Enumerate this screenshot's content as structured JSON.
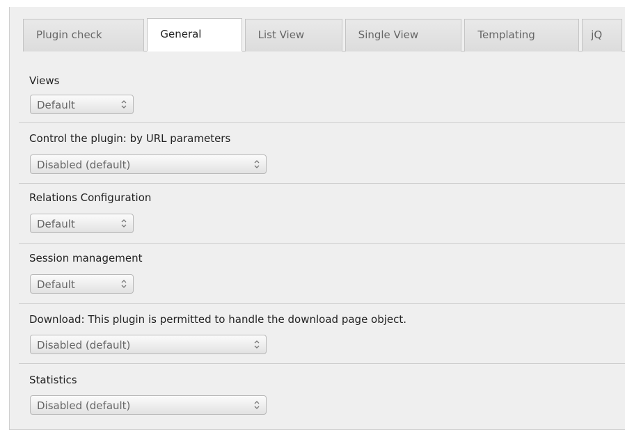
{
  "tabs": [
    {
      "label": "Plugin check",
      "active": false
    },
    {
      "label": "General",
      "active": true
    },
    {
      "label": "List View",
      "active": false
    },
    {
      "label": "Single View",
      "active": false
    },
    {
      "label": "Templating",
      "active": false
    },
    {
      "label": "jQ",
      "active": false
    }
  ],
  "fields": {
    "views": {
      "label": "Views",
      "value": "Default"
    },
    "control": {
      "label": "Control the plugin: by URL parameters",
      "value": "Disabled (default)"
    },
    "relations": {
      "label": "Relations Configuration",
      "value": "Default"
    },
    "session": {
      "label": "Session management",
      "value": "Default"
    },
    "download": {
      "label": "Download: This plugin is permitted to handle the download page object.",
      "value": "Disabled (default)"
    },
    "statistics": {
      "label": "Statistics",
      "value": "Disabled (default)"
    }
  },
  "icons": {
    "select_arrow": "up-down-chevron-icon"
  }
}
